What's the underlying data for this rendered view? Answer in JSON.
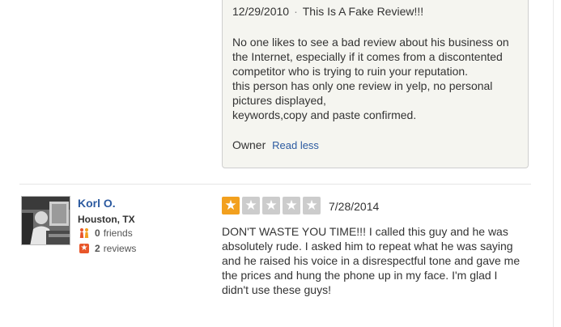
{
  "owner_comment": {
    "date": "12/29/2010",
    "separator": "·",
    "title": "This Is A Fake Review!!!",
    "paragraphs": [
      "No one likes to see a bad review about his business on the Internet, especially if it comes from a discontented competitor who is trying to ruin your reputation.",
      "this person has only one review in yelp, no personal pictures displayed,",
      "keywords,copy and paste confirmed."
    ],
    "label": "Owner",
    "toggle_label": "Read less"
  },
  "review": {
    "reviewer": {
      "name": "Korl O.",
      "location": "Houston, TX",
      "friends_count": "0",
      "friends_label": "friends",
      "reviews_count": "2",
      "reviews_label": "reviews"
    },
    "rating": 1,
    "rating_max": 5,
    "date": "7/28/2014",
    "text": "DON'T WASTE YOU TIME!!! I called this guy and he was absolutely rude. I asked him to repeat what he was saying and he raised his voice in a disrespectful tone and gave me the prices and hung the phone up in my face. I'm glad I didn't use these guys!"
  },
  "colors": {
    "link": "#2c5aa0",
    "star_on": "#f2a01e",
    "star_off": "#cccccc",
    "owner_box_bg": "#f5f5f0"
  }
}
